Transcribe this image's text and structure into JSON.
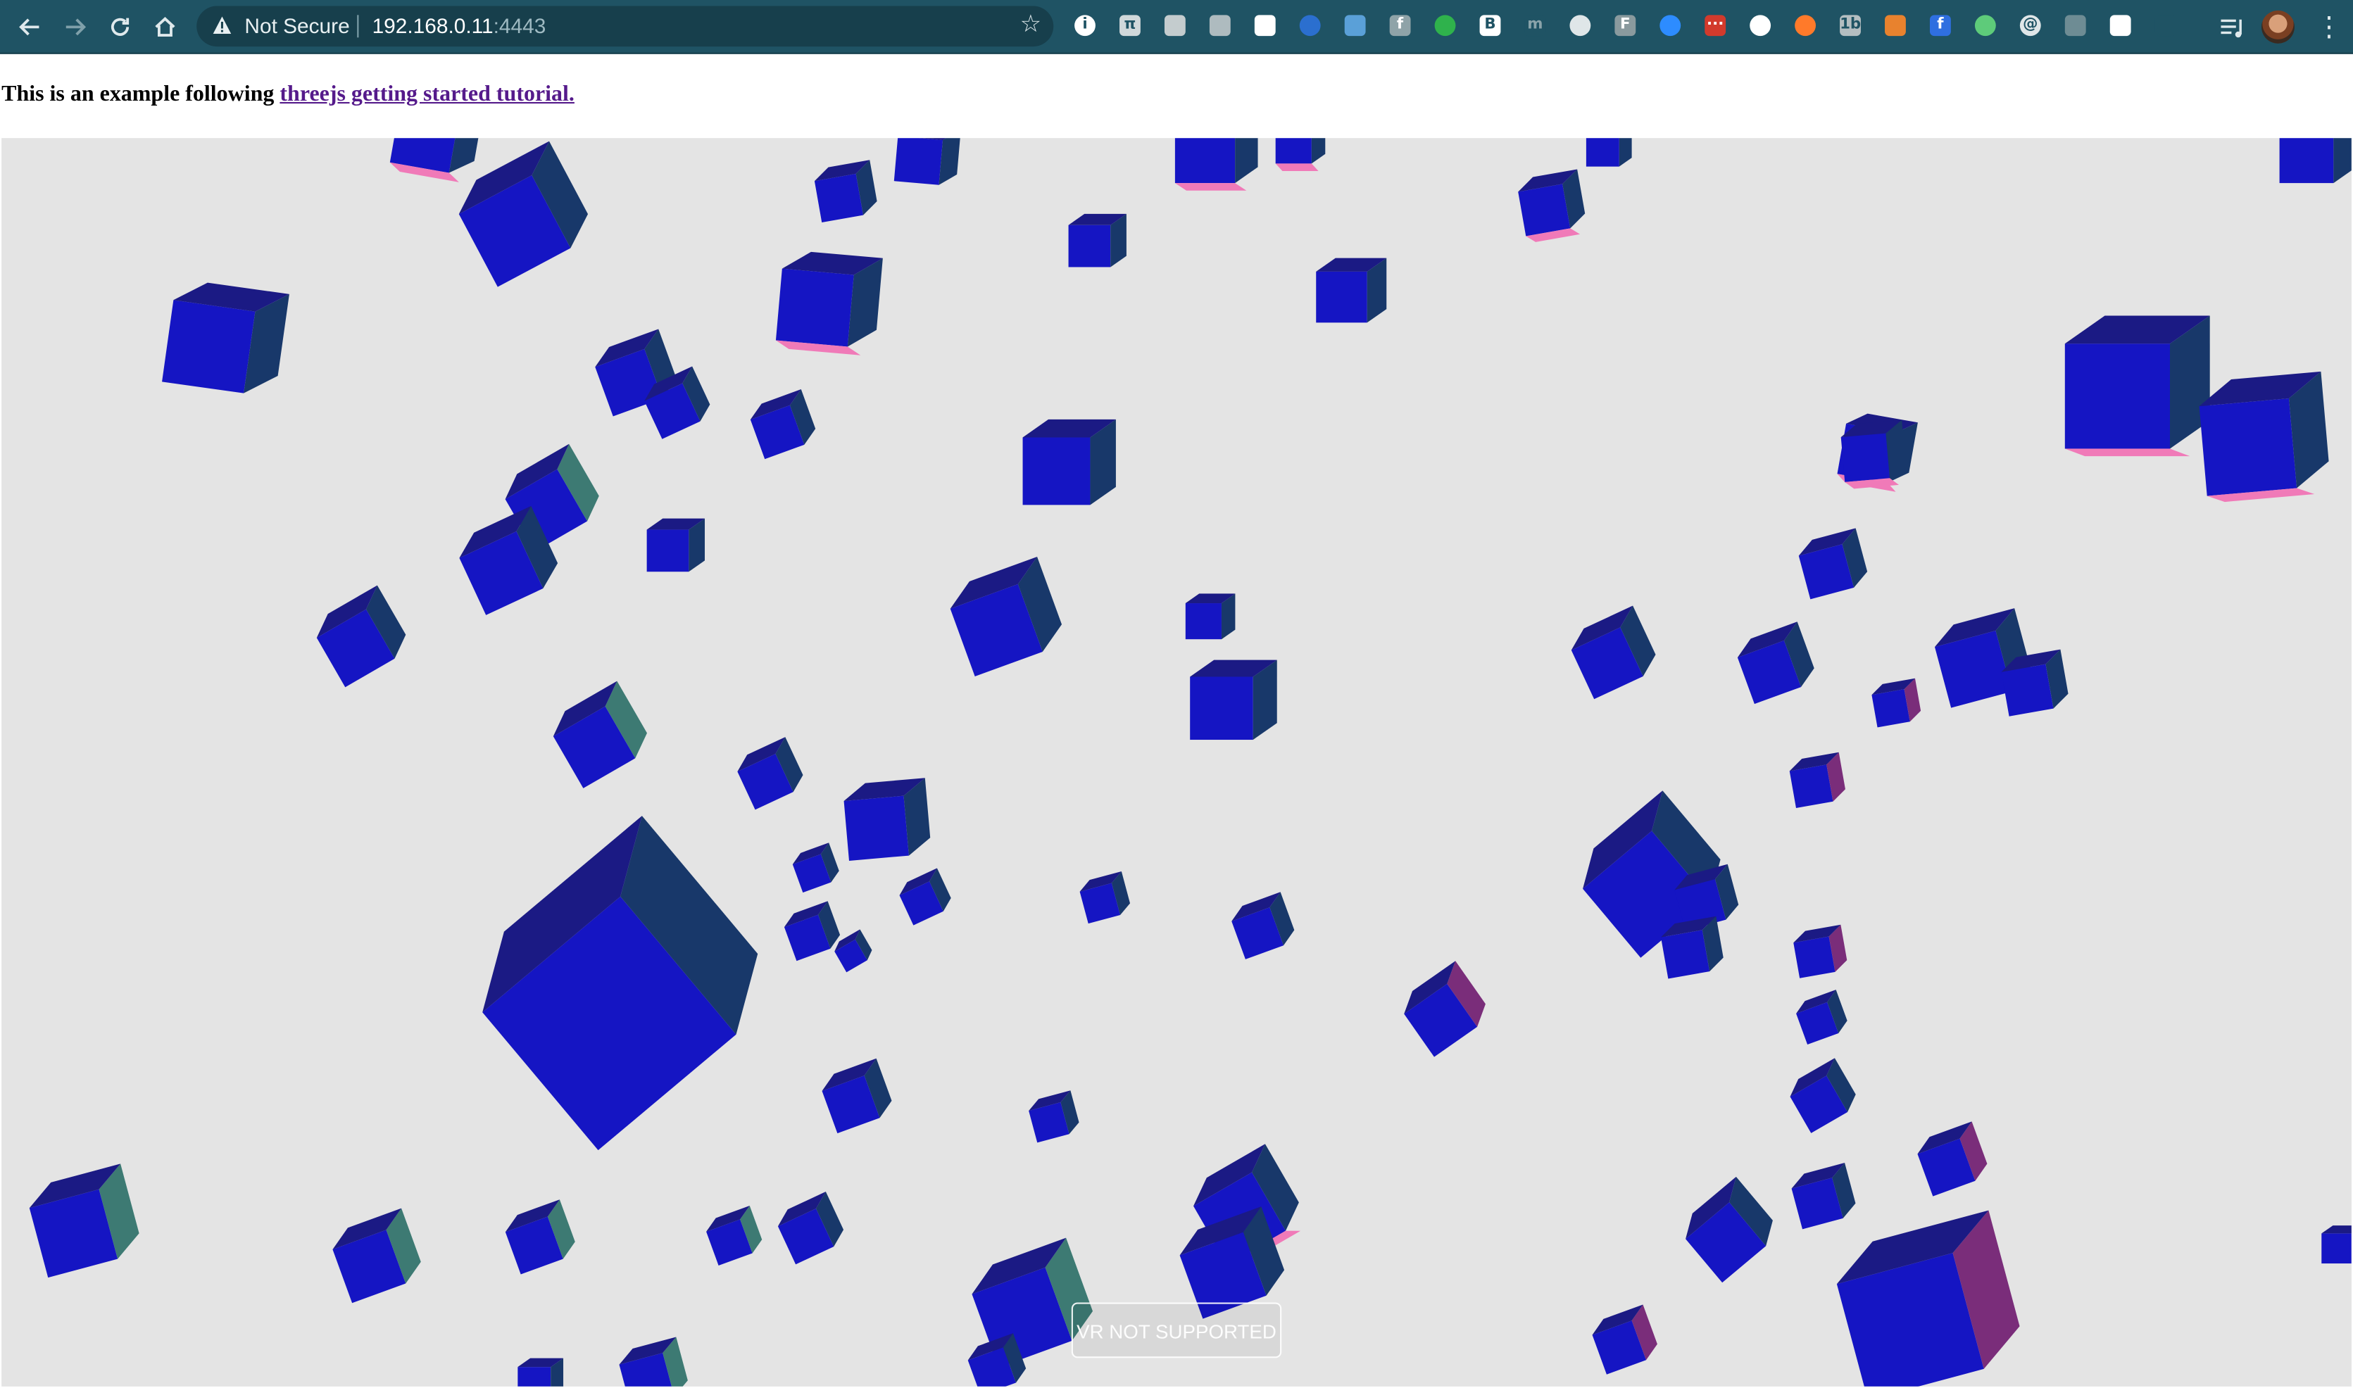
{
  "browser": {
    "security_label": "Not Secure",
    "url_host": "192.168.0.11",
    "url_port": ":4443",
    "extensions": [
      {
        "name": "info-extension-icon",
        "glyph": "i",
        "color": "#ffffff",
        "fg": "#1f5364",
        "round": true
      },
      {
        "name": "calculator-extension-icon",
        "glyph": "π",
        "color": "#d0d8da",
        "fg": "#1f5364",
        "round": false
      },
      {
        "name": "clipboard-extension-icon",
        "glyph": "",
        "color": "#c4ccce",
        "fg": "#1f5364",
        "round": false
      },
      {
        "name": "chat-extension-icon",
        "glyph": "",
        "color": "#aebbbf",
        "fg": "#1f5364",
        "round": false
      },
      {
        "name": "calendar-extension-icon",
        "glyph": "",
        "color": "#ffffff",
        "fg": "#cc2222",
        "round": false
      },
      {
        "name": "clock-extension-icon",
        "glyph": "",
        "color": "#2b6fcf",
        "fg": "#ffffff",
        "round": true
      },
      {
        "name": "pattern-extension-icon",
        "glyph": "",
        "color": "#5aa0d8",
        "fg": "#ffffff",
        "round": false
      },
      {
        "name": "facebook-extension-icon",
        "glyph": "f",
        "color": "#8fa3a8",
        "fg": "#ffffff",
        "round": false
      },
      {
        "name": "evernote-extension-icon",
        "glyph": "",
        "color": "#2fb24c",
        "fg": "#ffffff",
        "round": true
      },
      {
        "name": "bracket-extension-icon",
        "glyph": "B",
        "color": "#ffffff",
        "fg": "#1f5364",
        "round": false
      },
      {
        "name": "script-extension-icon",
        "glyph": "m",
        "color": "#1f5364",
        "fg": "#8aa3aa",
        "round": false
      },
      {
        "name": "circle-extension-icon",
        "glyph": "",
        "color": "#dfe6e8",
        "fg": "#1f5364",
        "round": true
      },
      {
        "name": "f-extension-icon",
        "glyph": "F",
        "color": "#8a9a9e",
        "fg": "#ffffff",
        "round": false
      },
      {
        "name": "zoom-extension-icon",
        "glyph": "",
        "color": "#2d8cff",
        "fg": "#ffffff",
        "round": true
      },
      {
        "name": "dots-extension-icon",
        "glyph": "···",
        "color": "#d23a2c",
        "fg": "#ffffff",
        "round": false
      },
      {
        "name": "shield-extension-icon",
        "glyph": "",
        "color": "#ffffff",
        "fg": "#1f5364",
        "round": true
      },
      {
        "name": "pill-extension-icon",
        "glyph": "",
        "color": "#ff7a2a",
        "fg": "#ffffff",
        "round": true
      },
      {
        "name": "1b-extension-icon",
        "glyph": "1b",
        "color": "#b4bec1",
        "fg": "#1f5364",
        "round": false
      },
      {
        "name": "fox-extension-icon",
        "glyph": "",
        "color": "#e8822e",
        "fg": "#ffffff",
        "round": false
      },
      {
        "name": "facebook-blue-extension-icon",
        "glyph": "f",
        "color": "#2f6fe0",
        "fg": "#ffffff",
        "round": false
      },
      {
        "name": "spotify-extension-icon",
        "glyph": "",
        "color": "#5ecb7a",
        "fg": "#ffffff",
        "round": true
      },
      {
        "name": "at-extension-icon",
        "glyph": "@",
        "color": "#dfe6e8",
        "fg": "#1f5364",
        "round": true
      },
      {
        "name": "robot-extension-icon",
        "glyph": "",
        "color": "#6e8c94",
        "fg": "#ffffff",
        "round": false
      },
      {
        "name": "calendar-red-extension-icon",
        "glyph": "",
        "color": "#ffffff",
        "fg": "#d23a2c",
        "round": false
      },
      {
        "name": "rocket-extension-icon",
        "glyph": "",
        "color": "#1f5364",
        "fg": "#ffffff",
        "round": false
      }
    ]
  },
  "page": {
    "intro_text": "This is an example following ",
    "link_text": "threejs getting started tutorial."
  },
  "scene": {
    "background_color": "#e4e4e4",
    "face_colors": {
      "front": "#1515c3",
      "top": "#1b1a84",
      "side": "#18386a",
      "side_teal": "#3d7a73",
      "bottom_pink": "#f07ab8",
      "side_purple": "#7a2d7a"
    },
    "vr_button_label": "VR NOT SUPPORTED"
  }
}
